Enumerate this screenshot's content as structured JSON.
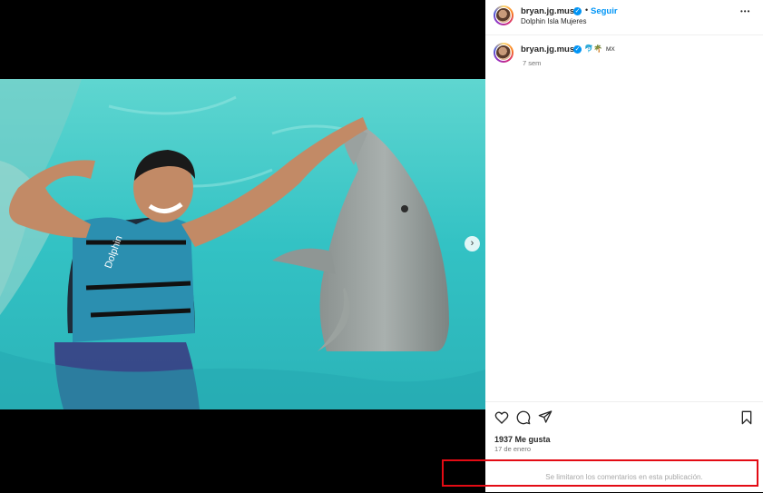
{
  "post": {
    "username": "bryan.jg.music",
    "separator": "•",
    "follow_label": "Seguir",
    "location": "Dolphin Isla Mujeres",
    "more_label": "•••"
  },
  "caption": {
    "username": "bryan.jg.music",
    "emojis": "🐬🌴",
    "country": "MX",
    "age": "7 sem"
  },
  "vest_text": "Dolphin",
  "stats": {
    "likes": "1937 Me gusta",
    "date": "17 de enero"
  },
  "comments_notice": "Se limitaron los comentarios en esta publicación.",
  "carousel": {
    "slides": 3,
    "current": 1
  },
  "icons": [
    "heart-icon",
    "comment-icon",
    "share-icon",
    "bookmark-icon",
    "verified-badge-icon",
    "more-icon",
    "chevron-right-icon"
  ],
  "colors": {
    "accent": "#0095f6",
    "highlight": "#e30b14",
    "water": "#3ec6c8"
  }
}
